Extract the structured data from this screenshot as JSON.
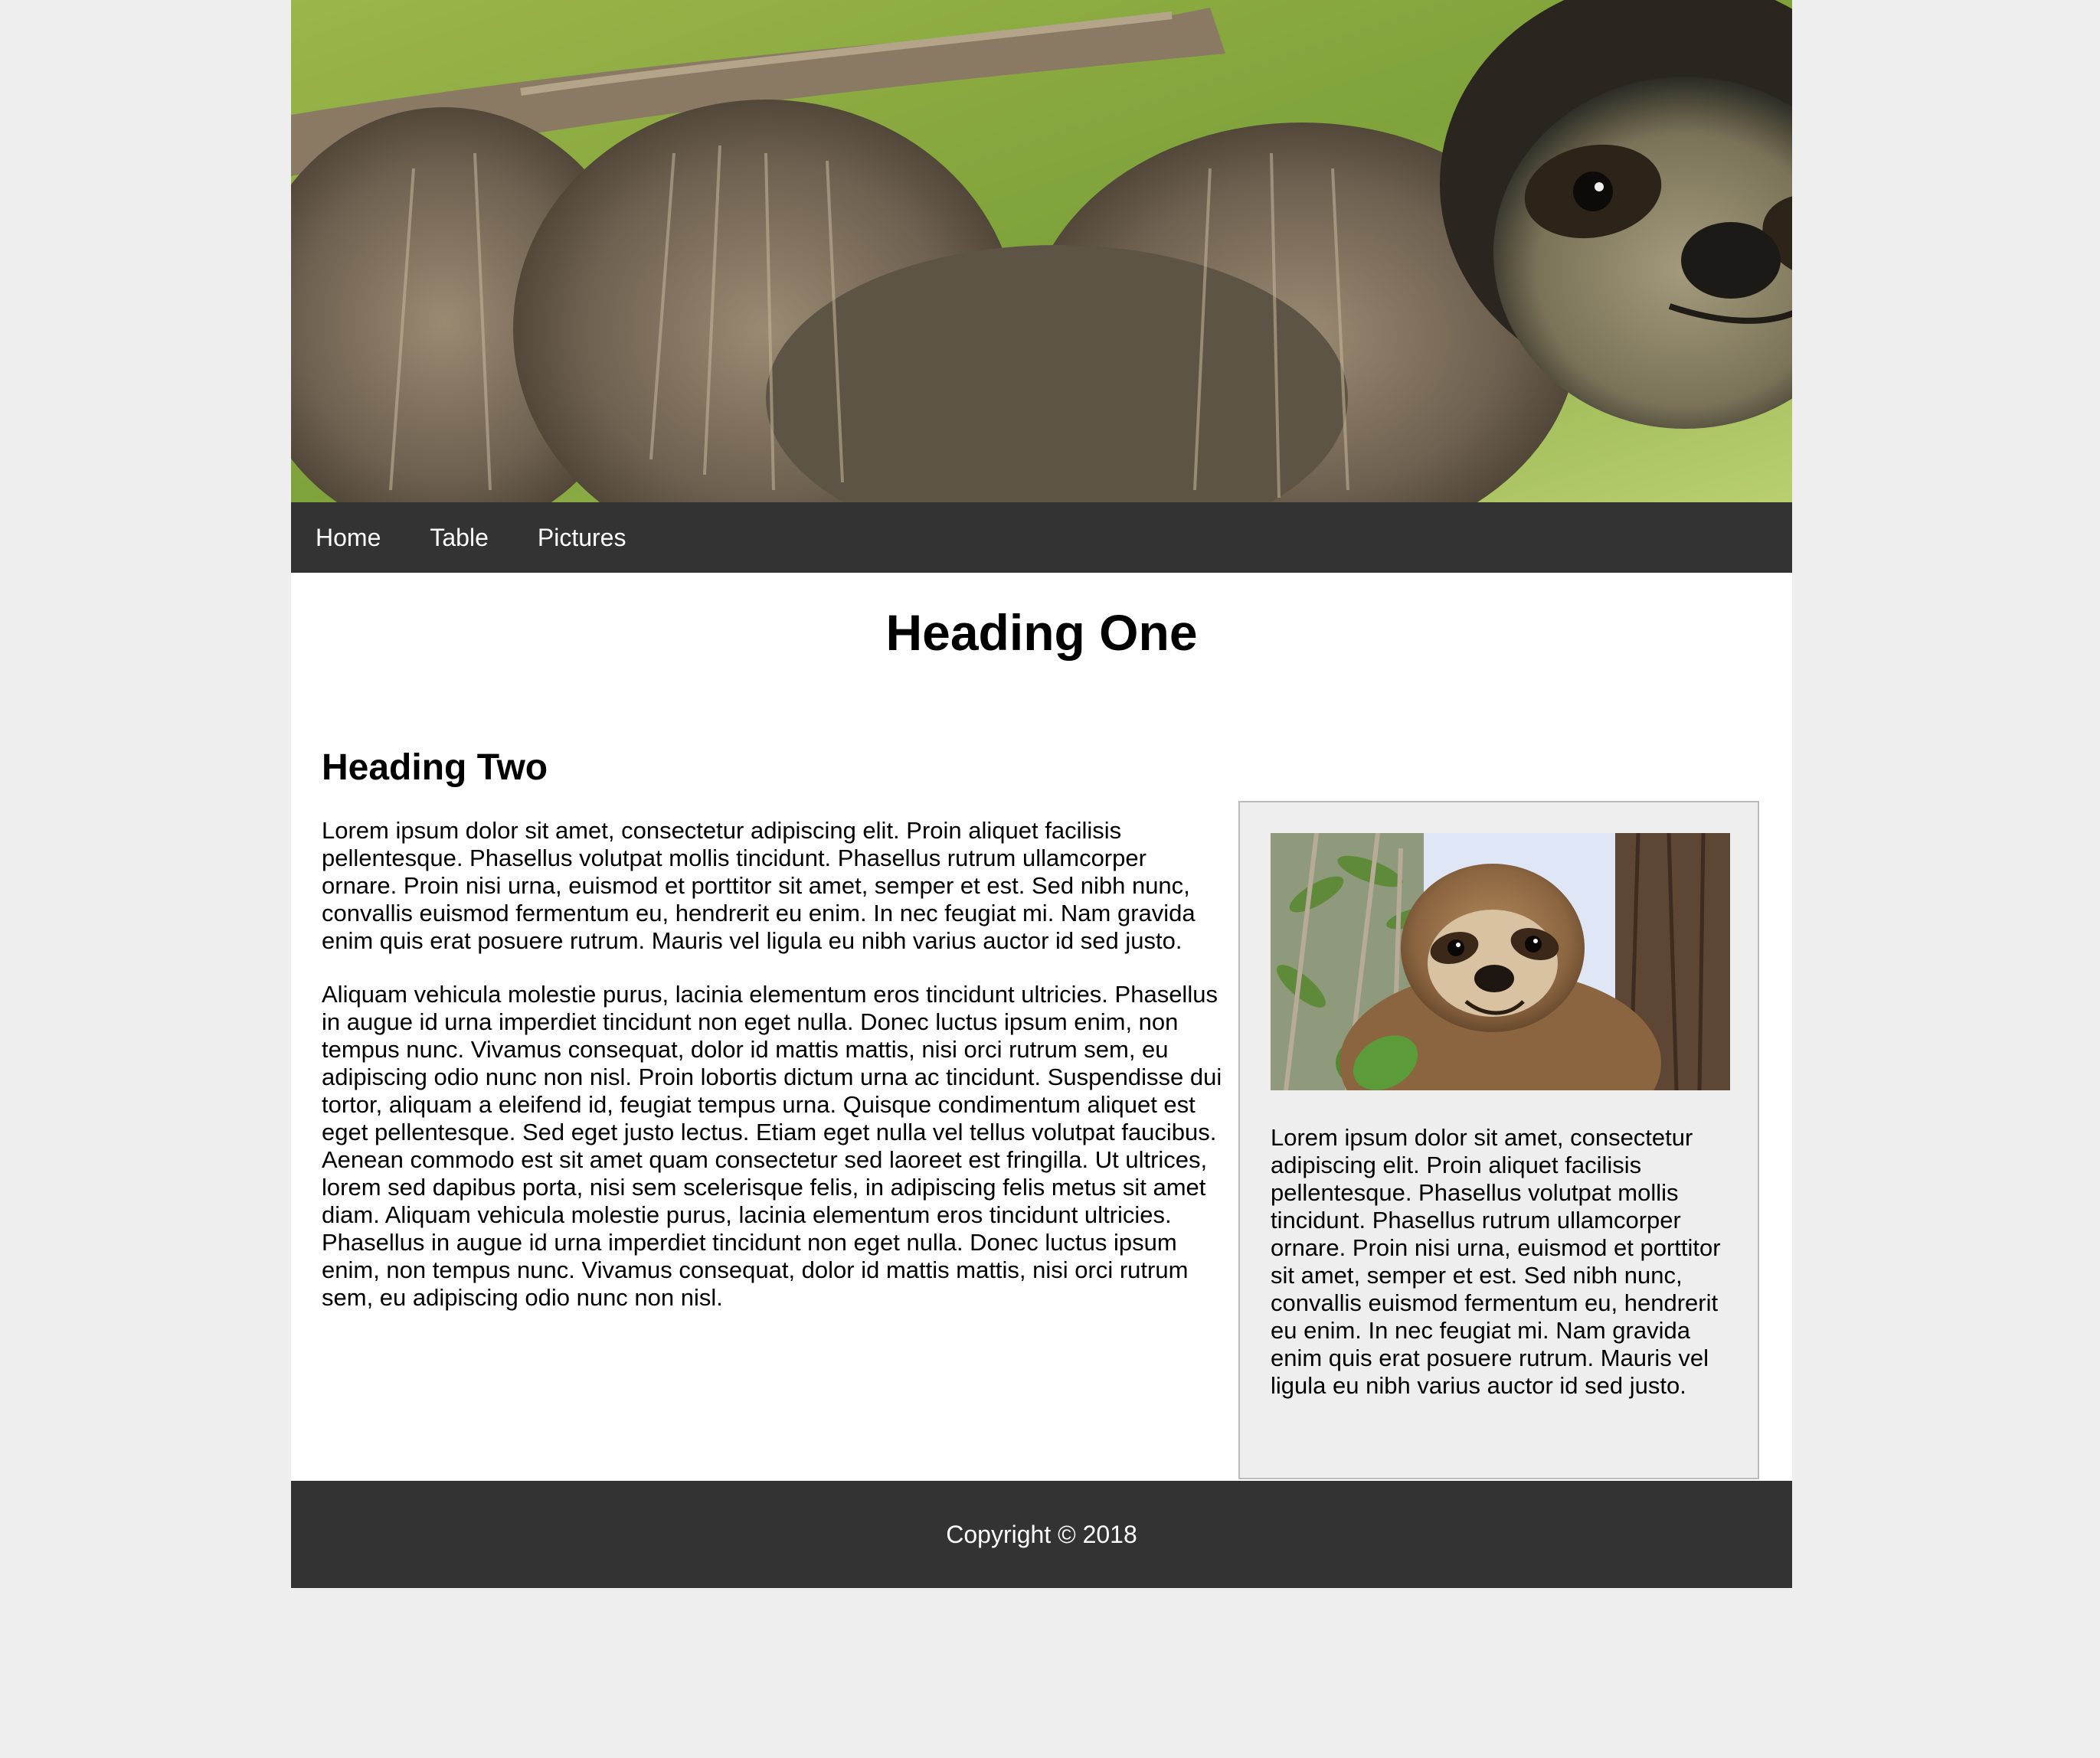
{
  "nav": {
    "items": [
      {
        "label": "Home"
      },
      {
        "label": "Table"
      },
      {
        "label": "Pictures"
      }
    ]
  },
  "main": {
    "heading_one": "Heading One",
    "heading_two": "Heading Two",
    "paragraphs": [
      "Lorem ipsum dolor sit amet, consectetur adipiscing elit. Proin aliquet facilisis pellentesque. Phasellus volutpat mollis tincidunt. Phasellus rutrum ullamcorper ornare. Proin nisi urna, euismod et porttitor sit amet, semper et est. Sed nibh nunc, convallis euismod fermentum eu, hendrerit eu enim. In nec feugiat mi. Nam gravida enim quis erat posuere rutrum. Mauris vel ligula eu nibh varius auctor id sed justo.",
      "Aliquam vehicula molestie purus, lacinia elementum eros tincidunt ultricies. Phasellus in augue id urna imperdiet tincidunt non eget nulla. Donec luctus ipsum enim, non tempus nunc. Vivamus consequat, dolor id mattis mattis, nisi orci rutrum sem, eu adipiscing odio nunc non nisl. Proin lobortis dictum urna ac tincidunt. Suspendisse dui tortor, aliquam a eleifend id, feugiat tempus urna. Quisque condimentum aliquet est eget pellentesque. Sed eget justo lectus. Etiam eget nulla vel tellus volutpat faucibus. Aenean commodo est sit amet quam consectetur sed laoreet est fringilla. Ut ultrices, lorem sed dapibus porta, nisi sem scelerisque felis, in adipiscing felis metus sit amet diam. Aliquam vehicula molestie purus, lacinia elementum eros tincidunt ultricies. Phasellus in augue id urna imperdiet tincidunt non eget nulla. Donec luctus ipsum enim, non tempus nunc. Vivamus consequat, dolor id mattis mattis, nisi orci rutrum sem, eu adipiscing odio nunc non nisl."
    ]
  },
  "aside": {
    "text": "Lorem ipsum dolor sit amet, consectetur adipiscing elit. Proin aliquet facilisis pellentesque. Phasellus volutpat mollis tincidunt. Phasellus rutrum ullamcorper ornare. Proin nisi urna, euismod et porttitor sit amet, semper et est. Sed nibh nunc, convallis euismod fermentum eu, hendrerit eu enim. In nec feugiat mi. Nam gravida enim quis erat posuere rutrum. Mauris vel ligula eu nibh varius auctor id sed justo."
  },
  "footer": {
    "copyright": "Copyright © 2018"
  },
  "colors": {
    "page_background": "#eeeeee",
    "nav_background": "#333333",
    "footer_background": "#333333",
    "aside_background": "#eeeeee",
    "aside_border": "#bbbbbb"
  }
}
